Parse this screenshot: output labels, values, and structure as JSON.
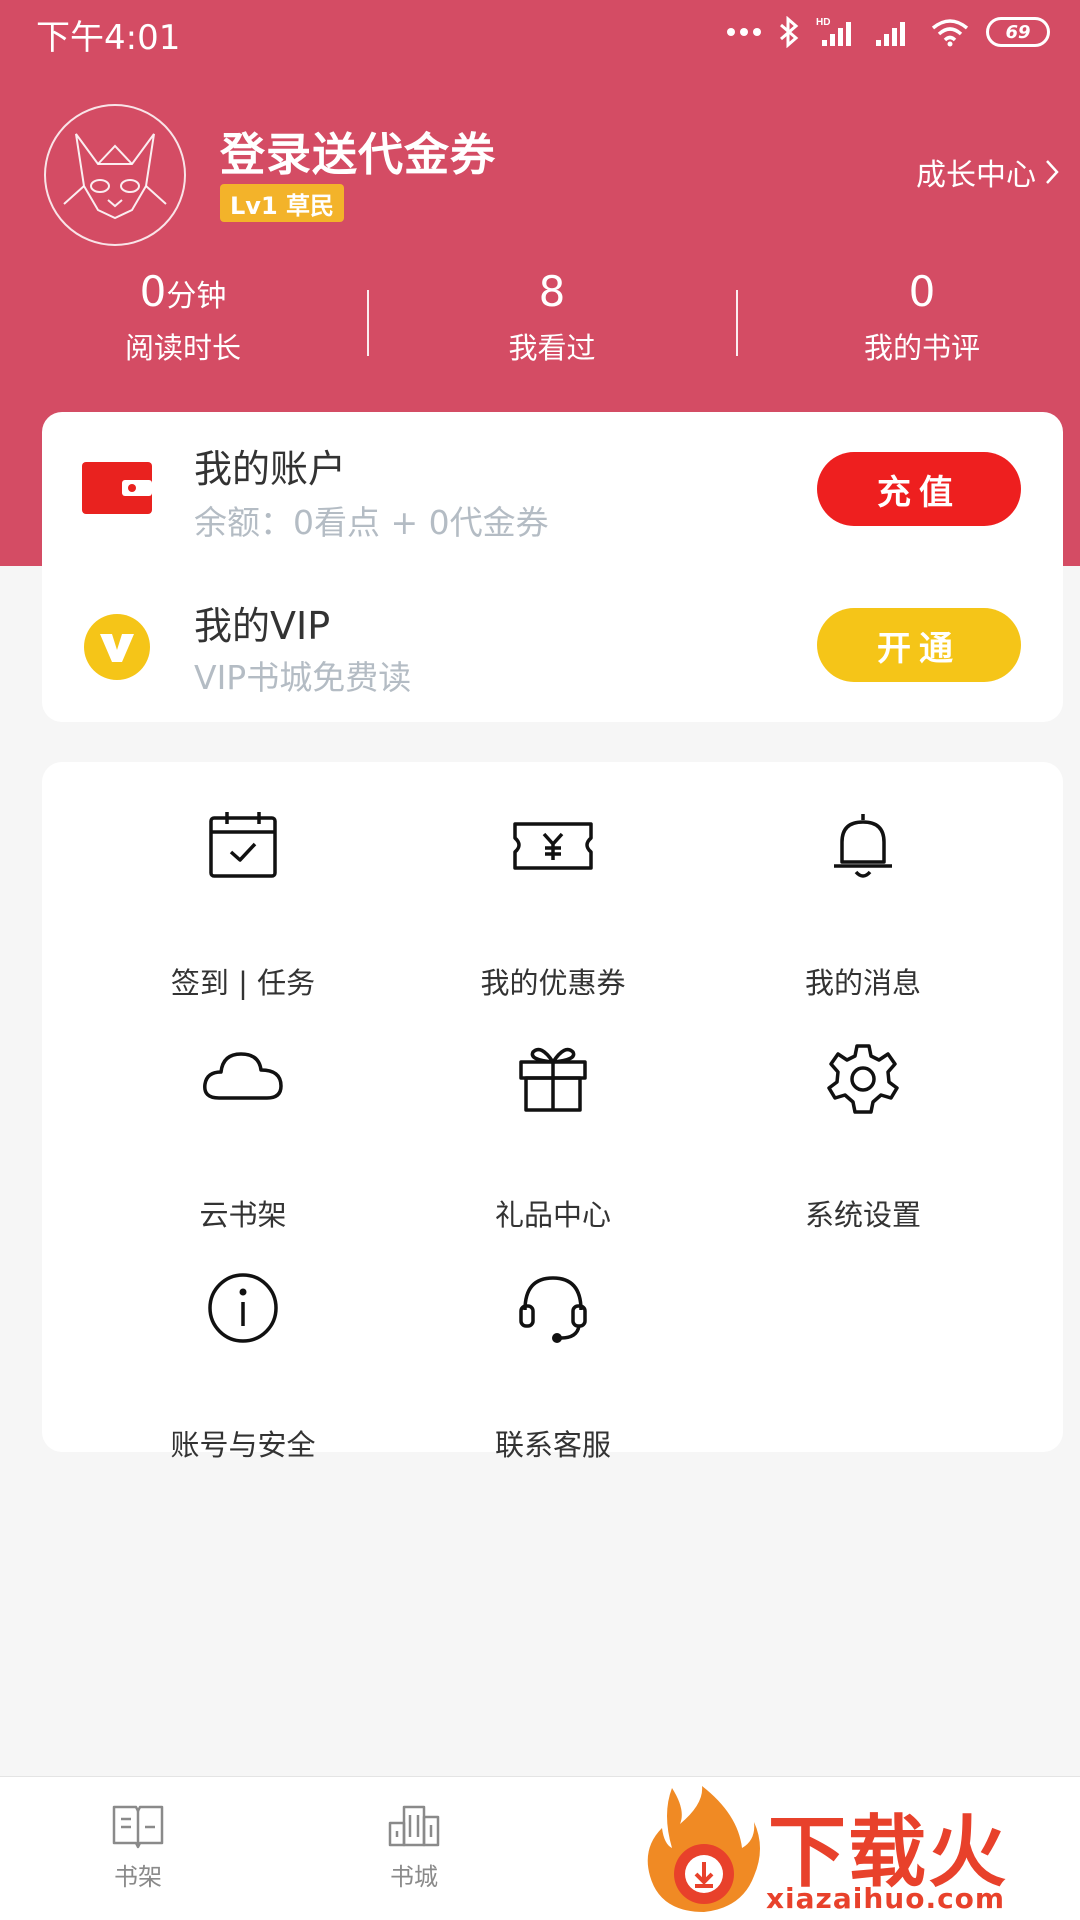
{
  "status_bar": {
    "time": "下午4:01",
    "battery": "69"
  },
  "profile": {
    "name": "登录送代金券",
    "level": "Lv1 草民",
    "growth_center": "成长中心"
  },
  "stats": [
    {
      "value": "0",
      "unit": "分钟",
      "label": "阅读时长"
    },
    {
      "value": "8",
      "unit": "",
      "label": "我看过"
    },
    {
      "value": "0",
      "unit": "",
      "label": "我的书评"
    }
  ],
  "account": {
    "title": "我的账户",
    "subtitle": "余额：0看点 + 0代金券",
    "button": "充值"
  },
  "vip": {
    "title": "我的VIP",
    "subtitle": "VIP书城免费读",
    "button": "开通"
  },
  "grid": [
    {
      "label": "签到 | 任务",
      "icon": "calendar-check-icon"
    },
    {
      "label": "我的优惠券",
      "icon": "coupon-icon"
    },
    {
      "label": "我的消息",
      "icon": "bell-icon"
    },
    {
      "label": "云书架",
      "icon": "cloud-icon"
    },
    {
      "label": "礼品中心",
      "icon": "gift-icon"
    },
    {
      "label": "系统设置",
      "icon": "gear-icon"
    },
    {
      "label": "账号与安全",
      "icon": "info-icon"
    },
    {
      "label": "联系客服",
      "icon": "headset-icon"
    }
  ],
  "bottom_nav": [
    {
      "label": "书架",
      "icon": "book-icon"
    },
    {
      "label": "书城",
      "icon": "buildings-icon"
    }
  ],
  "watermark": {
    "title": "下载火",
    "url": "xiazaihuo.com"
  },
  "colors": {
    "header": "#d44c64",
    "recharge_button": "#ee1f1f",
    "vip_button": "#f5c518",
    "level_badge": "#f3b32a"
  }
}
